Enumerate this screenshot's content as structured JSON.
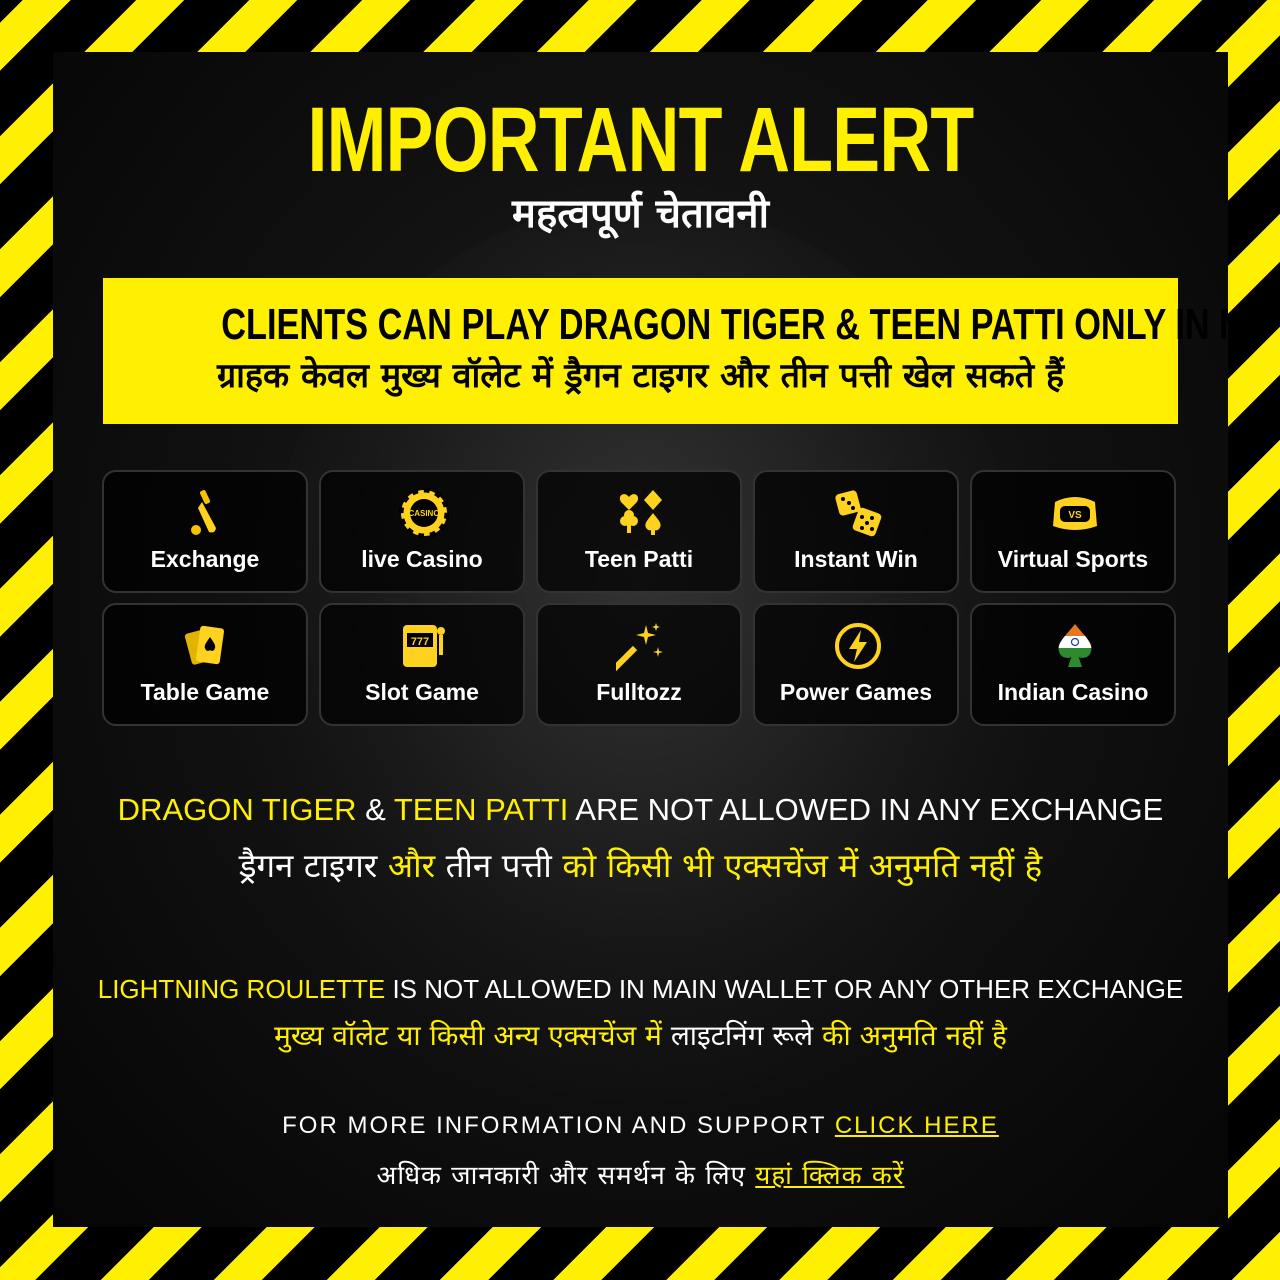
{
  "header": {
    "title": "IMPORTANT ALERT",
    "subtitle": "महत्वपूर्ण चेतावनी"
  },
  "banner": {
    "en": "CLIENTS CAN PLAY DRAGON TIGER & TEEN PATTI ONLY IN MAIN WALLET",
    "hi": "ग्राहक केवल मुख्य वॉलेट में ड्रैगन टाइगर और तीन पत्ती खेल सकते हैं"
  },
  "games": [
    {
      "label": "Exchange",
      "icon": "cricket-bat-icon"
    },
    {
      "label": "live Casino",
      "icon": "casino-chip-icon"
    },
    {
      "label": "Teen Patti",
      "icon": "card-suits-icon"
    },
    {
      "label": "Instant Win",
      "icon": "dice-icon"
    },
    {
      "label": "Virtual Sports",
      "icon": "vr-headset-icon"
    },
    {
      "label": "Table Game",
      "icon": "playing-cards-icon"
    },
    {
      "label": "Slot Game",
      "icon": "slot-machine-icon"
    },
    {
      "label": "Fulltozz",
      "icon": "magic-wand-icon"
    },
    {
      "label": "Power Games",
      "icon": "lightning-icon"
    },
    {
      "label": "Indian Casino",
      "icon": "spade-flag-icon"
    }
  ],
  "rule1": {
    "en_part1": "DRAGON TIGER",
    "en_part2": " & ",
    "en_part3": "TEEN PATTI",
    "en_part4": " ARE NOT ALLOWED IN ANY EXCHANGE",
    "hi_part1": "ड्रैगन टाइगर ",
    "hi_part2": "और",
    "hi_part3": " तीन पत्ती ",
    "hi_part4": "को किसी भी एक्सचेंज में अनुमति नहीं है"
  },
  "rule2": {
    "en_part1": "LIGHTNING ROULETTE",
    "en_part2": " IS NOT ALLOWED IN MAIN WALLET OR ANY OTHER EXCHANGE",
    "hi_part1": "मुख्य वॉलेट या किसी अन्य एक्सचेंज में ",
    "hi_part2": "लाइटनिंग रूले",
    "hi_part3": " की अनुमति नहीं है"
  },
  "support": {
    "en_text": "FOR MORE INFORMATION AND SUPPORT ",
    "en_link": "CLICK HERE",
    "hi_text": "अधिक जानकारी और समर्थन के लिए ",
    "hi_link": "यहां क्लिक करें"
  },
  "colors": {
    "accent": "#ffef00",
    "background": "#000000",
    "text": "#ffffff"
  }
}
